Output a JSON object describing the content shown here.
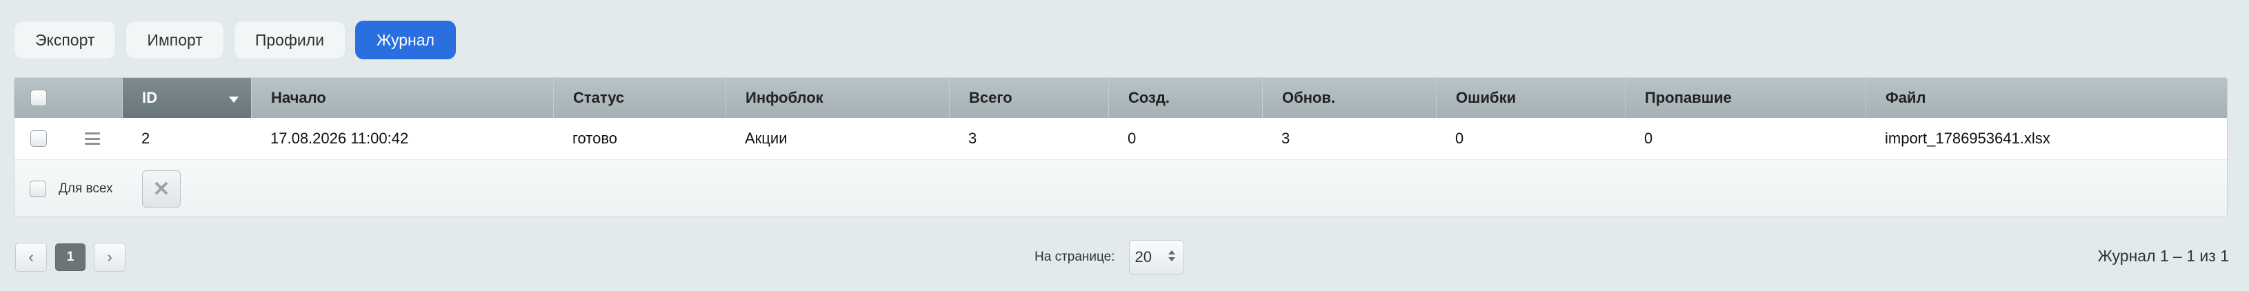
{
  "tabs": [
    {
      "label": "Экспорт",
      "active": false
    },
    {
      "label": "Импорт",
      "active": false
    },
    {
      "label": "Профили",
      "active": false
    },
    {
      "label": "Журнал",
      "active": true
    }
  ],
  "grid": {
    "columns": [
      "ID",
      "Начало",
      "Статус",
      "Инфоблок",
      "Всего",
      "Созд.",
      "Обнов.",
      "Ошибки",
      "Пропавшие",
      "Файл"
    ],
    "sorted_column": "ID",
    "sort_direction": "desc",
    "rows": [
      {
        "id": "2",
        "start": "17.08.2026 11:00:42",
        "status": "готово",
        "iblock": "Акции",
        "total": "3",
        "created": "0",
        "updated": "3",
        "errors": "0",
        "missing": "0",
        "file": "import_1786953641.xlsx"
      }
    ],
    "for_all_label": "Для всех",
    "delete_icon": "close-icon"
  },
  "pagination": {
    "prev_icon": "chevron-left-icon",
    "next_icon": "chevron-right-icon",
    "current_page": "1",
    "per_page_label": "На странице:",
    "per_page_value": "20",
    "summary": "Журнал 1 – 1 из 1"
  },
  "colors": {
    "accent": "#2a6fe0",
    "status_ok": "#2a8a22",
    "background": "#e3eaec"
  }
}
